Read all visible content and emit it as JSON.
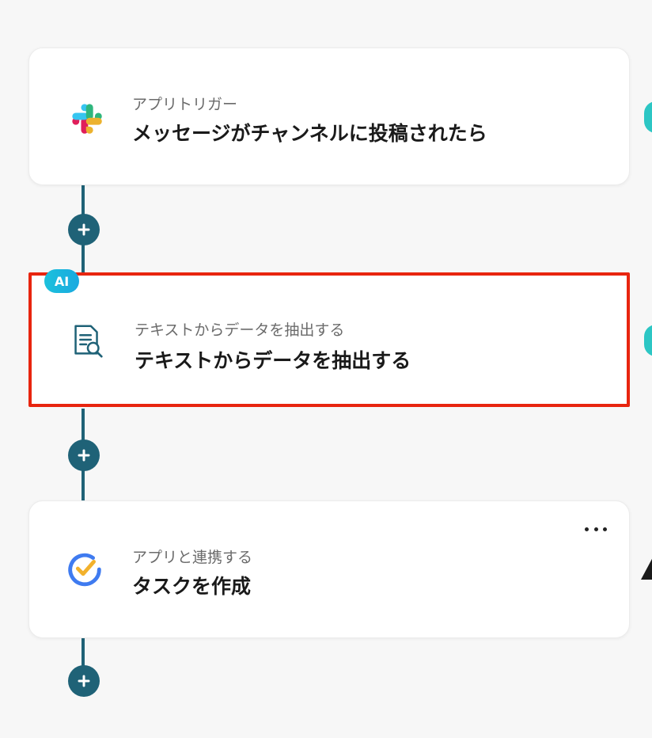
{
  "flow": {
    "steps": [
      {
        "subtitle": "アプリトリガー",
        "title": "メッセージがチャンネルに投稿されたら",
        "icon": "slack-icon"
      },
      {
        "badge": "AI",
        "subtitle": "テキストからデータを抽出する",
        "title": "テキストからデータを抽出する",
        "icon": "document-search-icon"
      },
      {
        "subtitle": "アプリと連携する",
        "title": "タスクを作成",
        "icon": "task-check-icon"
      }
    ],
    "colors": {
      "connector": "#1f6277",
      "selection_border": "#e8250f",
      "ai_badge": "#1cc1dc",
      "edge_indicator": "#2cc6c4"
    }
  }
}
